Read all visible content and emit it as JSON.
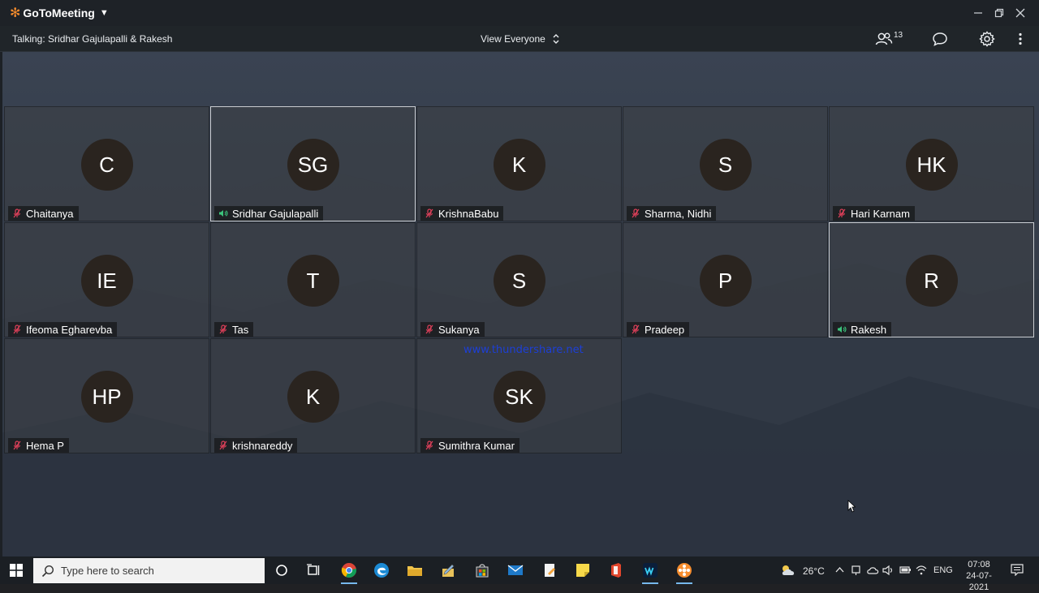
{
  "app": {
    "name": "GoToMeeting"
  },
  "toolbar": {
    "talking": "Talking: Sridhar Gajulapalli & Rakesh",
    "view_label": "View Everyone",
    "participant_count": "13"
  },
  "participants": [
    {
      "initials": "C",
      "name": "Chaitanya",
      "speaking": false
    },
    {
      "initials": "SG",
      "name": "Sridhar Gajulapalli",
      "speaking": true
    },
    {
      "initials": "K",
      "name": "KrishnaBabu",
      "speaking": false
    },
    {
      "initials": "S",
      "name": "Sharma, Nidhi",
      "speaking": false
    },
    {
      "initials": "HK",
      "name": "Hari Karnam",
      "speaking": false
    },
    {
      "initials": "IE",
      "name": "Ifeoma Egharevba",
      "speaking": false
    },
    {
      "initials": "T",
      "name": "Tas",
      "speaking": false
    },
    {
      "initials": "S",
      "name": "Sukanya",
      "speaking": false
    },
    {
      "initials": "P",
      "name": "Pradeep",
      "speaking": false
    },
    {
      "initials": "R",
      "name": "Rakesh",
      "speaking": true
    },
    {
      "initials": "HP",
      "name": "Hema P",
      "speaking": false
    },
    {
      "initials": "K",
      "name": "krishnareddy",
      "speaking": false
    },
    {
      "initials": "SK",
      "name": "Sumithra Kumar",
      "speaking": false
    }
  ],
  "watermark": "www.thundershare.net",
  "taskbar": {
    "search_placeholder": "Type here to search",
    "temperature": "26°C",
    "language": "ENG",
    "time": "07:08",
    "date": "24-07-2021"
  },
  "colors": {
    "brand": "#f68d2e",
    "muted_mic": "#e0405a",
    "speaking_mic": "#3cc47c",
    "avatar_bg": "#2a241f"
  }
}
